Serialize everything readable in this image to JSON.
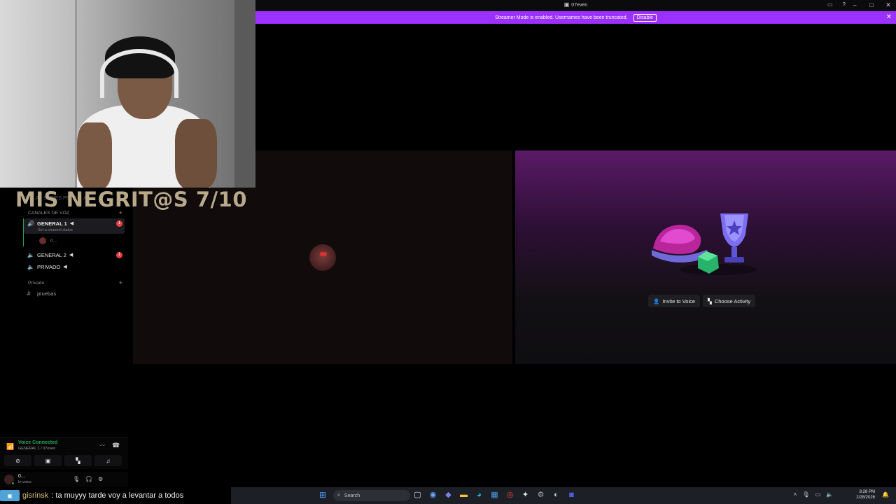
{
  "window": {
    "title": "07even"
  },
  "overlay": {
    "title": "MIS NEGRIT@S 7/10"
  },
  "banner": {
    "text": "Streamer Mode is enabled. Usernames have been truncated.",
    "disable_label": "Disable"
  },
  "sidebar": {
    "faded_header": "REGLAS SERIES PELICULAS",
    "voice_category": "CANALES DE VOZ",
    "channels": [
      {
        "label": "GENERAL 1",
        "badge": "1"
      },
      {
        "label": "GENERAL 2",
        "badge": "1"
      },
      {
        "label": "PRIVADO"
      }
    ],
    "channel_status": "Set a channel status",
    "voice_user": "0...",
    "private_category": "Privado",
    "text_channel": "pruebas"
  },
  "voice_panel": {
    "title": "Voice Connected",
    "subtitle": "GENERAL 1 / 07even"
  },
  "user_panel": {
    "name": "0...",
    "status": "In voice"
  },
  "tile_actions": {
    "invite": "Invite to Voice",
    "activity": "Choose Activity"
  },
  "chat": {
    "user": "gisrinsk",
    "message": ": ta muyyy tarde voy a levantar a todos"
  },
  "taskbar": {
    "search_placeholder": "Search",
    "time": "8:28 PM",
    "date": "2/28/2026"
  },
  "colors": {
    "accent": "#9b30ff",
    "voice_green": "#23a55a",
    "badge_red": "#f23f43"
  }
}
